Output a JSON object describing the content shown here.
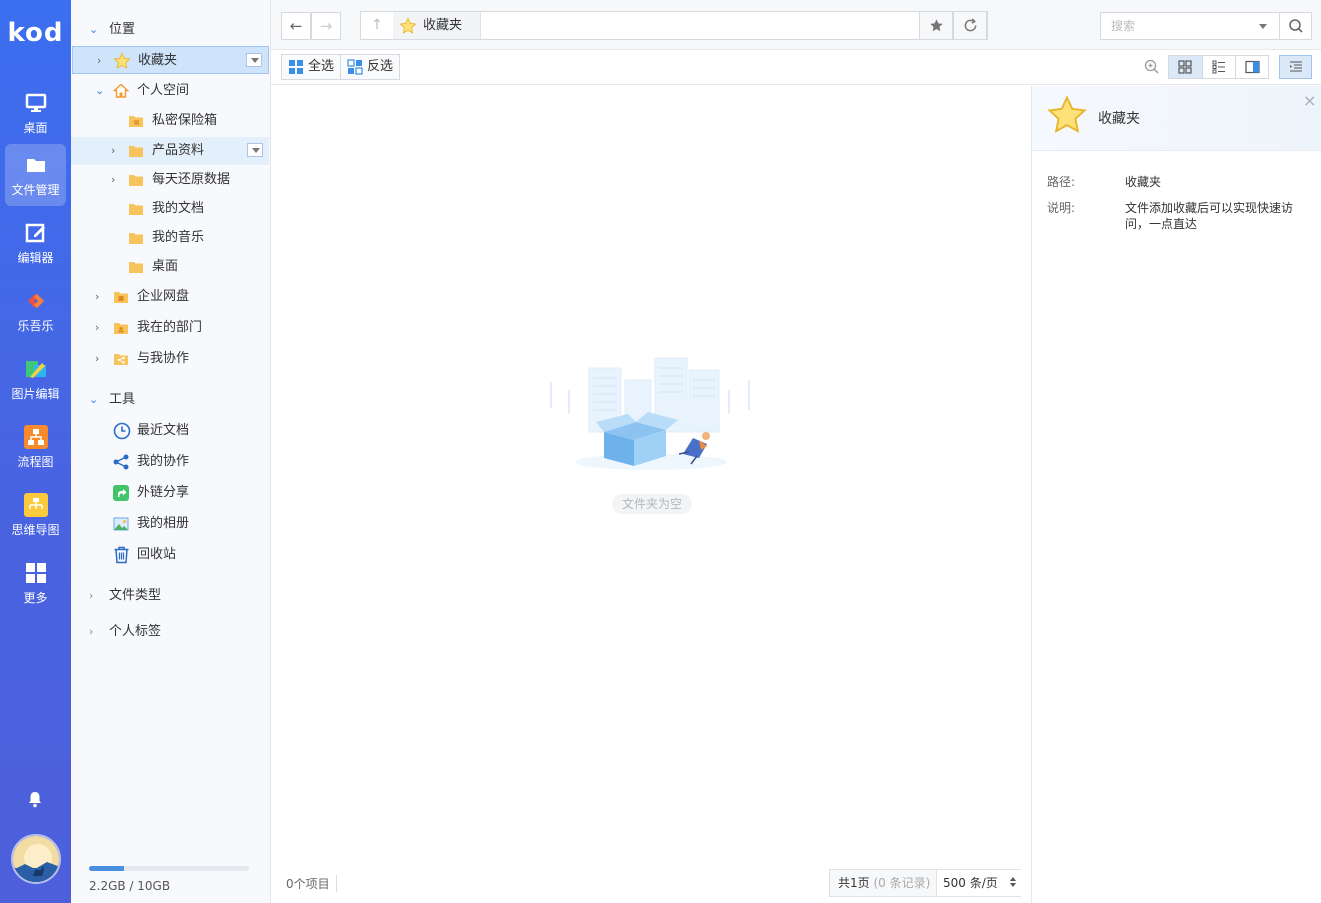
{
  "app": {
    "logo": "kod"
  },
  "rail": {
    "items": [
      {
        "label": "桌面",
        "icon": "monitor-icon"
      },
      {
        "label": "文件管理",
        "icon": "folder-icon",
        "active": true
      },
      {
        "label": "编辑器",
        "icon": "edit-icon"
      },
      {
        "label": "乐吾乐",
        "icon": "le5le-icon"
      },
      {
        "label": "图片编辑",
        "icon": "image-edit-icon"
      },
      {
        "label": "流程图",
        "icon": "flowchart-icon"
      },
      {
        "label": "思维导图",
        "icon": "mindmap-icon"
      },
      {
        "label": "更多",
        "icon": "grid-icon"
      }
    ]
  },
  "tree": {
    "location": "位置",
    "favorites": "收藏夹",
    "personal": "个人空间",
    "safe": "私密保险箱",
    "product": "产品资料",
    "restore": "每天还原数据",
    "docs": "我的文档",
    "music": "我的音乐",
    "desktop": "桌面",
    "enterprise": "企业网盘",
    "department": "我在的部门",
    "shared": "与我协作",
    "tools": "工具",
    "recent": "最近文档",
    "mycollab": "我的协作",
    "extshare": "外链分享",
    "album": "我的相册",
    "recycle": "回收站",
    "filetype": "文件类型",
    "tags": "个人标签"
  },
  "quota": {
    "text": "2.2GB / 10GB",
    "used_fraction": 0.22
  },
  "path": {
    "current": "收藏夹"
  },
  "search": {
    "placeholder": "搜索"
  },
  "toolbar": {
    "select_all": "全选",
    "invert": "反选"
  },
  "content": {
    "empty": "文件夹为空"
  },
  "status": {
    "count": "0个项目",
    "pages": "共1页",
    "records": "(0 条记录)",
    "page_size": "500 条/页"
  },
  "info": {
    "title": "收藏夹",
    "path_label": "路径:",
    "path_value": "收藏夹",
    "desc_label": "说明:",
    "desc_value": "文件添加收藏后可以实现快速访问，一点直达"
  },
  "colors": {
    "rail": "#3b6ef0",
    "accent": "#3a7ee4",
    "selected": "#cfe3fb",
    "folder": "#f7c35c"
  }
}
